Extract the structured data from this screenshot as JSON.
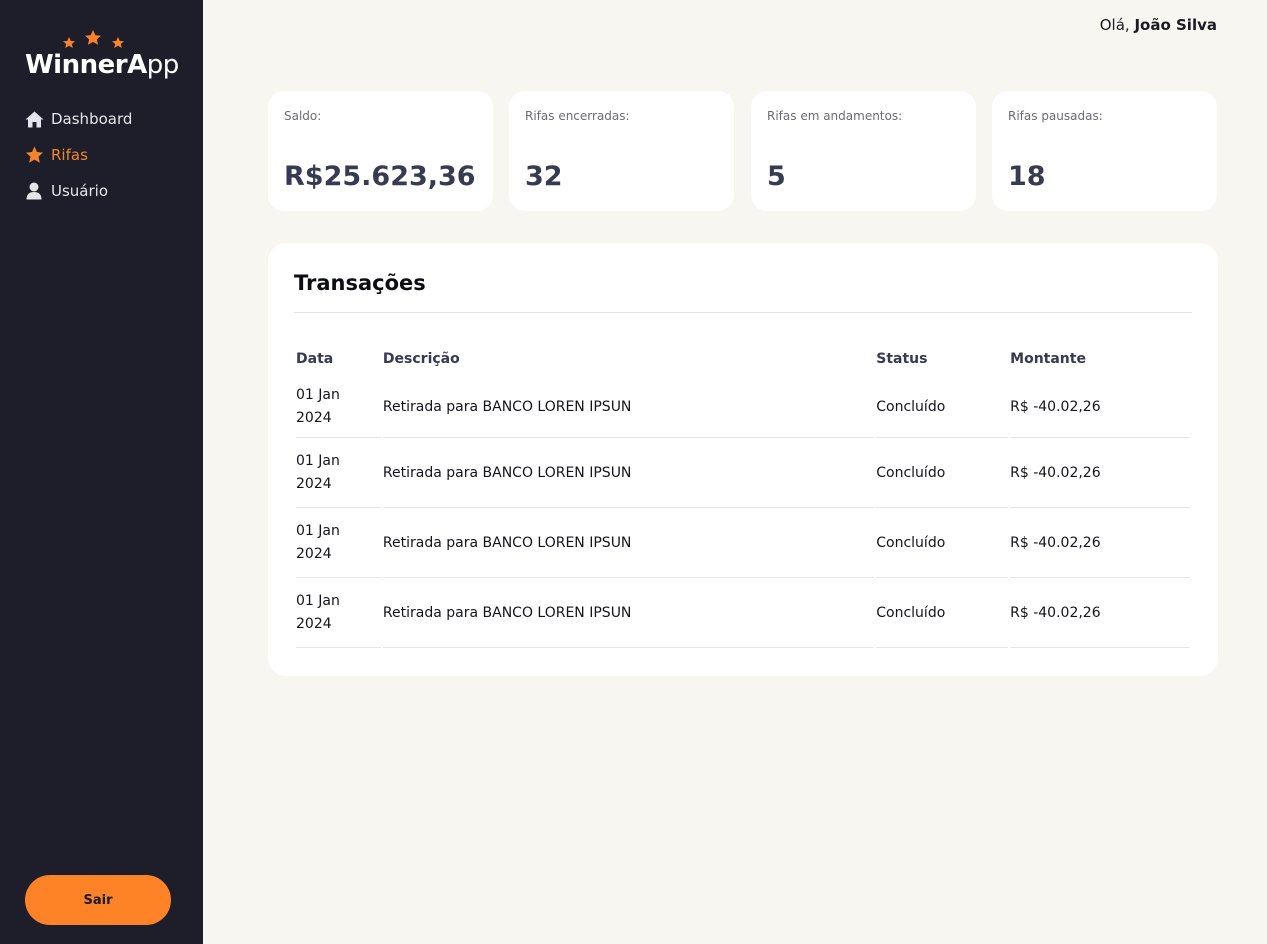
{
  "app": {
    "logo_part1": "Winner",
    "logo_part2": "A",
    "logo_part3": "pp"
  },
  "colors": {
    "accent": "#fd8326",
    "sidebar_bg": "#1e1e2a",
    "page_bg": "#f7f6f0",
    "value_text": "#363a52"
  },
  "sidebar": {
    "items": [
      {
        "label": "Dashboard",
        "icon": "home-icon",
        "active": false
      },
      {
        "label": "Rifas",
        "icon": "star-icon",
        "active": true
      },
      {
        "label": "Usuário",
        "icon": "user-icon",
        "active": false
      }
    ],
    "logout_label": "Sair"
  },
  "header": {
    "greeting_prefix": "Olá,",
    "user_name": "João Silva"
  },
  "stats": [
    {
      "label": "Saldo:",
      "value": "R$25.623,36"
    },
    {
      "label": "Rifas encerradas:",
      "value": "32"
    },
    {
      "label": "Rifas em andamentos:",
      "value": "5"
    },
    {
      "label": "Rifas pausadas:",
      "value": "18"
    }
  ],
  "transactions": {
    "title": "Transações",
    "columns": [
      "Data",
      "Descrição",
      "Status",
      "Montante"
    ],
    "rows": [
      {
        "date_day": "01 Jan",
        "date_year": "2024",
        "description": "Retirada para BANCO LOREN IPSUN",
        "status": "Concluído",
        "amount": "R$ -40.02,26"
      },
      {
        "date_day": "01 Jan",
        "date_year": "2024",
        "description": "Retirada para BANCO LOREN IPSUN",
        "status": "Concluído",
        "amount": "R$ -40.02,26"
      },
      {
        "date_day": "01 Jan",
        "date_year": "2024",
        "description": "Retirada para BANCO LOREN IPSUN",
        "status": "Concluído",
        "amount": "R$ -40.02,26"
      },
      {
        "date_day": "01 Jan",
        "date_year": "2024",
        "description": "Retirada para BANCO LOREN IPSUN",
        "status": "Concluído",
        "amount": "R$ -40.02,26"
      }
    ]
  }
}
